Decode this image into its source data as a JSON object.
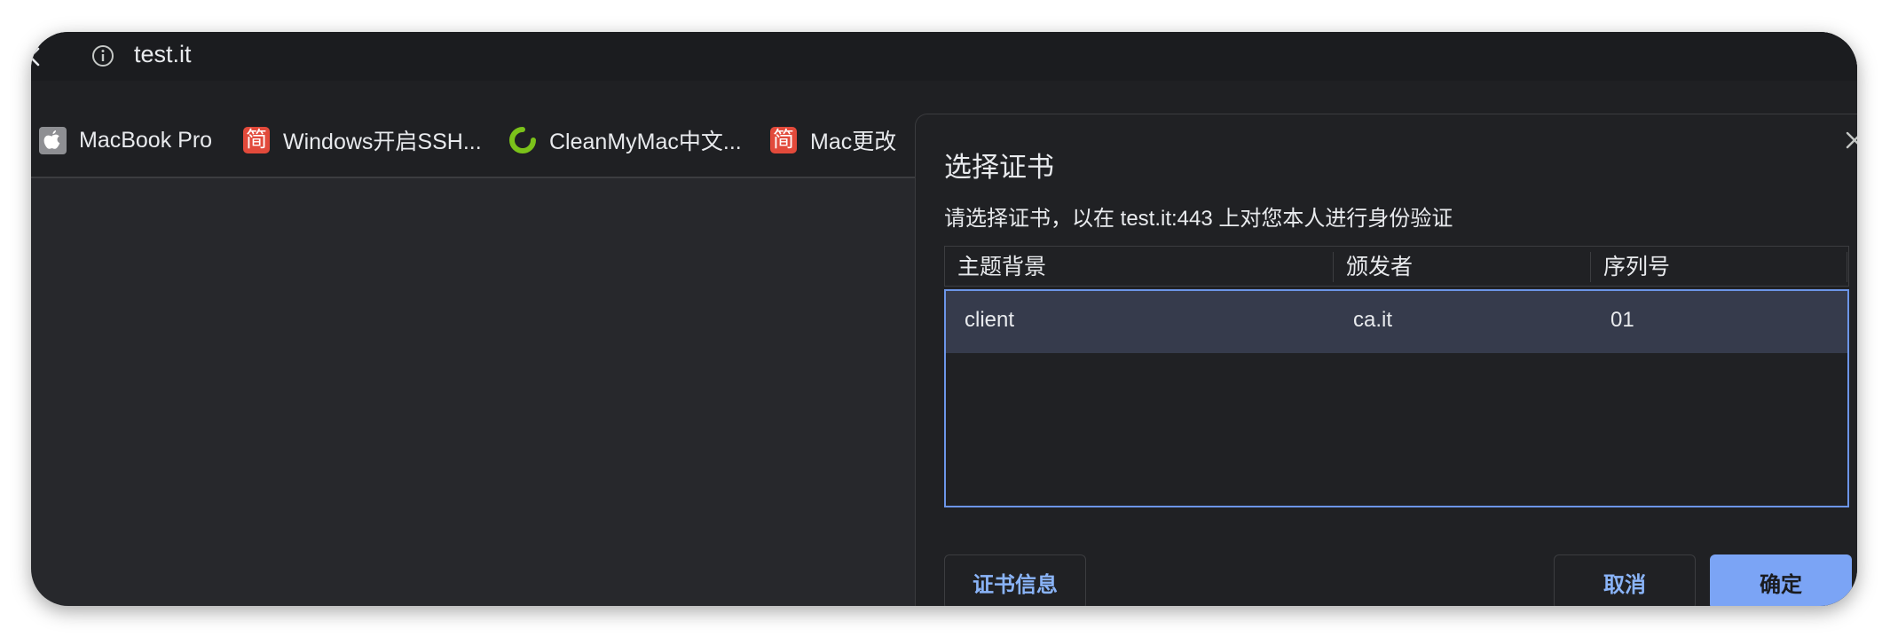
{
  "browser": {
    "url": "test.it",
    "bookmarks": [
      {
        "label": "MacBook Pro",
        "icon": "apple-icon"
      },
      {
        "label": "Windows开启SSH...",
        "icon": "jian-icon",
        "glyph": "简"
      },
      {
        "label": "CleanMyMac中文...",
        "icon": "cleanmymac-icon"
      },
      {
        "label": "Mac更改",
        "icon": "jian-icon",
        "glyph": "简"
      }
    ]
  },
  "dialog": {
    "title": "选择证书",
    "description": "请选择证书，以在 test.it:443 上对您本人进行身份验证",
    "columns": [
      "主题背景",
      "颁发者",
      "序列号"
    ],
    "rows": [
      {
        "subject": "client",
        "issuer": "ca.it",
        "serial": "01",
        "selected": true
      }
    ],
    "cert_info_button": "证书信息",
    "cancel_button": "取消",
    "ok_button": "确定"
  },
  "colors": {
    "accent": "#7ba4f5",
    "link": "#8ab4f8",
    "selected_row": "#363b4c",
    "dialog_bg": "#202124"
  }
}
